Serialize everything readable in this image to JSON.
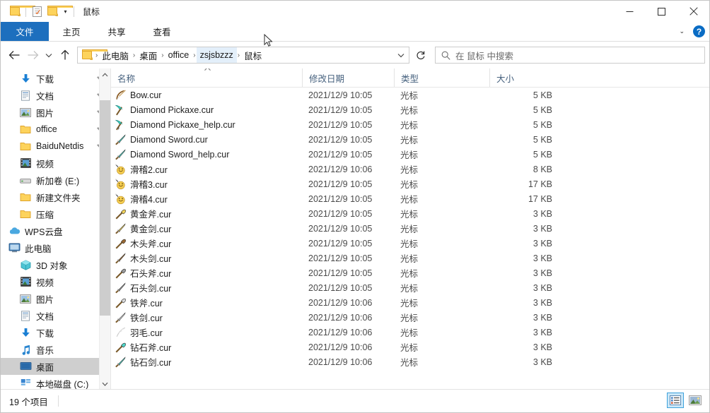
{
  "window": {
    "title": "鼠标",
    "quick_access": [
      {
        "name": "folder-icon",
        "label": "文件夹"
      },
      {
        "name": "properties-icon",
        "label": "属性"
      },
      {
        "name": "new-folder-icon",
        "label": "新建文件夹"
      }
    ],
    "customize_arrow": "▾",
    "controls": {
      "minimize": "—",
      "maximize": "□",
      "close": "✕"
    }
  },
  "ribbon": {
    "tabs": [
      {
        "label": "文件",
        "active": true
      },
      {
        "label": "主页",
        "active": false
      },
      {
        "label": "共享",
        "active": false
      },
      {
        "label": "查看",
        "active": false
      }
    ],
    "expand_arrow": "⌄",
    "help_label": "?"
  },
  "address": {
    "back_label": "←",
    "forward_label": "→",
    "recent_label": "⌄",
    "up_label": "↑",
    "refresh_label": "↻",
    "dropdown_label": "⌄",
    "breadcrumb_separator": "›",
    "breadcrumbs": [
      {
        "label": "此电脑",
        "highlighted": false
      },
      {
        "label": "桌面",
        "highlighted": false
      },
      {
        "label": "office",
        "highlighted": false
      },
      {
        "label": "zsjsbzzz",
        "highlighted": true
      },
      {
        "label": "鼠标",
        "highlighted": false
      }
    ]
  },
  "search": {
    "placeholder": "在 鼠标 中搜索",
    "icon": "search-icon"
  },
  "sidebar": {
    "scroll_up": "⌃",
    "scroll_down": "⌄",
    "items": [
      {
        "label": "下载",
        "icon": "download-icon",
        "level": 1,
        "pinned": true,
        "selected": false
      },
      {
        "label": "文档",
        "icon": "document-icon",
        "level": 1,
        "pinned": true,
        "selected": false
      },
      {
        "label": "图片",
        "icon": "pictures-icon",
        "level": 1,
        "pinned": true,
        "selected": false
      },
      {
        "label": "office",
        "icon": "folder-icon",
        "level": 1,
        "pinned": true,
        "selected": false
      },
      {
        "label": "BaiduNetdis",
        "icon": "folder-icon",
        "level": 1,
        "pinned": true,
        "selected": false
      },
      {
        "label": "视频",
        "icon": "video-icon",
        "level": 1,
        "pinned": false,
        "selected": false
      },
      {
        "label": "新加卷 (E:)",
        "icon": "drive-icon",
        "level": 1,
        "pinned": false,
        "selected": false
      },
      {
        "label": "新建文件夹",
        "icon": "folder-icon",
        "level": 1,
        "pinned": false,
        "selected": false
      },
      {
        "label": "压缩",
        "icon": "folder-icon",
        "level": 1,
        "pinned": false,
        "selected": false
      },
      {
        "label": "WPS云盘",
        "icon": "cloud-icon",
        "level": 0,
        "pinned": false,
        "selected": false
      },
      {
        "label": "此电脑",
        "icon": "this-pc-icon",
        "level": 0,
        "pinned": false,
        "selected": false
      },
      {
        "label": "3D 对象",
        "icon": "3d-objects-icon",
        "level": 1,
        "pinned": false,
        "selected": false
      },
      {
        "label": "视频",
        "icon": "video-icon",
        "level": 1,
        "pinned": false,
        "selected": false
      },
      {
        "label": "图片",
        "icon": "pictures-icon",
        "level": 1,
        "pinned": false,
        "selected": false
      },
      {
        "label": "文档",
        "icon": "document-icon",
        "level": 1,
        "pinned": false,
        "selected": false
      },
      {
        "label": "下载",
        "icon": "download-icon",
        "level": 1,
        "pinned": false,
        "selected": false
      },
      {
        "label": "音乐",
        "icon": "music-icon",
        "level": 1,
        "pinned": false,
        "selected": false
      },
      {
        "label": "桌面",
        "icon": "desktop-icon",
        "level": 1,
        "pinned": false,
        "selected": true
      },
      {
        "label": "本地磁盘 (C:)",
        "icon": "local-disk-icon",
        "level": 1,
        "pinned": false,
        "selected": false
      }
    ]
  },
  "file_list": {
    "columns": [
      {
        "label": "名称",
        "key": "name",
        "sorted": "asc"
      },
      {
        "label": "修改日期",
        "key": "date"
      },
      {
        "label": "类型",
        "key": "type"
      },
      {
        "label": "大小",
        "key": "size"
      }
    ],
    "sort_caret": "⌃",
    "rows": [
      {
        "name": "Bow.cur",
        "date": "2021/12/9 10:05",
        "type": "光标",
        "size": "5 KB",
        "icon": "bow-cursor-icon"
      },
      {
        "name": "Diamond Pickaxe.cur",
        "date": "2021/12/9 10:05",
        "type": "光标",
        "size": "5 KB",
        "icon": "pickaxe-cursor-icon"
      },
      {
        "name": "Diamond Pickaxe_help.cur",
        "date": "2021/12/9 10:05",
        "type": "光标",
        "size": "5 KB",
        "icon": "pickaxe-help-cursor-icon"
      },
      {
        "name": "Diamond Sword.cur",
        "date": "2021/12/9 10:05",
        "type": "光标",
        "size": "5 KB",
        "icon": "sword-cursor-icon"
      },
      {
        "name": "Diamond Sword_help.cur",
        "date": "2021/12/9 10:05",
        "type": "光标",
        "size": "5 KB",
        "icon": "sword-help-cursor-icon"
      },
      {
        "name": "滑稽2.cur",
        "date": "2021/12/9 10:06",
        "type": "光标",
        "size": "8 KB",
        "icon": "smiley-cursor-icon"
      },
      {
        "name": "滑稽3.cur",
        "date": "2021/12/9 10:05",
        "type": "光标",
        "size": "17 KB",
        "icon": "smiley-cursor-icon"
      },
      {
        "name": "滑稽4.cur",
        "date": "2021/12/9 10:05",
        "type": "光标",
        "size": "17 KB",
        "icon": "smiley-cursor-icon"
      },
      {
        "name": "黄金斧.cur",
        "date": "2021/12/9 10:05",
        "type": "光标",
        "size": "3 KB",
        "icon": "gold-axe-cursor-icon"
      },
      {
        "name": "黄金剑.cur",
        "date": "2021/12/9 10:05",
        "type": "光标",
        "size": "3 KB",
        "icon": "gold-sword-cursor-icon"
      },
      {
        "name": "木头斧.cur",
        "date": "2021/12/9 10:05",
        "type": "光标",
        "size": "3 KB",
        "icon": "wood-axe-cursor-icon"
      },
      {
        "name": "木头剑.cur",
        "date": "2021/12/9 10:05",
        "type": "光标",
        "size": "3 KB",
        "icon": "wood-sword-cursor-icon"
      },
      {
        "name": "石头斧.cur",
        "date": "2021/12/9 10:05",
        "type": "光标",
        "size": "3 KB",
        "icon": "stone-axe-cursor-icon"
      },
      {
        "name": "石头剑.cur",
        "date": "2021/12/9 10:05",
        "type": "光标",
        "size": "3 KB",
        "icon": "stone-sword-cursor-icon"
      },
      {
        "name": "铁斧.cur",
        "date": "2021/12/9 10:06",
        "type": "光标",
        "size": "3 KB",
        "icon": "iron-axe-cursor-icon"
      },
      {
        "name": "铁剑.cur",
        "date": "2021/12/9 10:06",
        "type": "光标",
        "size": "3 KB",
        "icon": "iron-sword-cursor-icon"
      },
      {
        "name": "羽毛.cur",
        "date": "2021/12/9 10:06",
        "type": "光标",
        "size": "3 KB",
        "icon": "feather-cursor-icon"
      },
      {
        "name": "钻石斧.cur",
        "date": "2021/12/9 10:06",
        "type": "光标",
        "size": "3 KB",
        "icon": "diamond-axe-cursor-icon"
      },
      {
        "name": "钻石剑.cur",
        "date": "2021/12/9 10:06",
        "type": "光标",
        "size": "3 KB",
        "icon": "diamond-sword-cursor-icon"
      }
    ]
  },
  "status": {
    "item_count": "19 个项目",
    "views": [
      {
        "name": "details-view-button",
        "active": true
      },
      {
        "name": "large-icons-view-button",
        "active": false
      }
    ]
  },
  "colors": {
    "accent": "#1d6fbe",
    "crumb_highlight": "#e3effa",
    "selection": "#cfcfcf",
    "header_text": "#46617e"
  }
}
